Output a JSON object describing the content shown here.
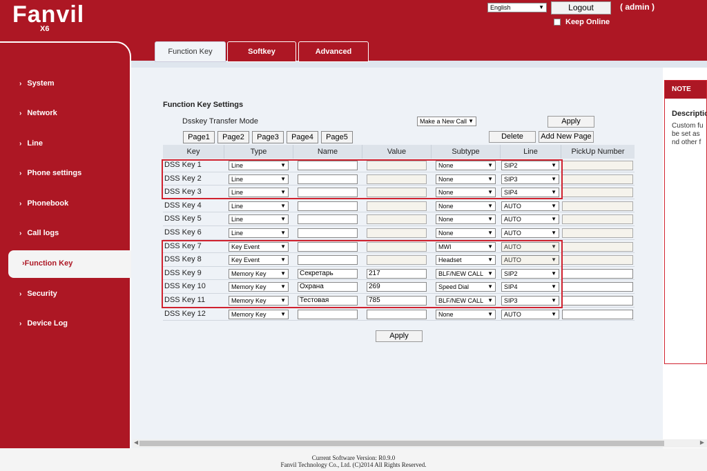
{
  "brand": {
    "logo": "Fanvil",
    "model": "X6"
  },
  "topbar": {
    "language": "English",
    "logout_label": "Logout",
    "user": "( admin )",
    "keep_online": "Keep Online"
  },
  "tabs": [
    {
      "label": "Function Key",
      "active": true
    },
    {
      "label": "Softkey",
      "active": false
    },
    {
      "label": "Advanced",
      "active": false
    }
  ],
  "sidebar": {
    "items": [
      {
        "label": "System"
      },
      {
        "label": "Network"
      },
      {
        "label": "Line"
      },
      {
        "label": "Phone settings"
      },
      {
        "label": "Phonebook"
      },
      {
        "label": "Call logs"
      },
      {
        "label": "Function Key",
        "active": true
      },
      {
        "label": "Security"
      },
      {
        "label": "Device Log"
      }
    ],
    "chevron": "›"
  },
  "settings": {
    "title": "Function Key Settings",
    "transfer_mode_label": "Dsskey Transfer Mode",
    "transfer_mode_value": "Make a New Call",
    "apply_label": "Apply",
    "delete_label": "Delete",
    "add_page_label": "Add New Page",
    "pages": [
      "Page1",
      "Page2",
      "Page3",
      "Page4",
      "Page5"
    ],
    "bottom_apply_label": "Apply"
  },
  "table": {
    "headers": [
      "Key",
      "Type",
      "Name",
      "Value",
      "Subtype",
      "Line",
      "PickUp Number"
    ],
    "rows": [
      {
        "key": "DSS Key 1",
        "type": "Line",
        "name": "",
        "value": "",
        "subtype": "None",
        "line": "SIP2",
        "pickup": ""
      },
      {
        "key": "DSS Key 2",
        "type": "Line",
        "name": "",
        "value": "",
        "subtype": "None",
        "line": "SIP3",
        "pickup": ""
      },
      {
        "key": "DSS Key 3",
        "type": "Line",
        "name": "",
        "value": "",
        "subtype": "None",
        "line": "SIP4",
        "pickup": ""
      },
      {
        "key": "DSS Key 4",
        "type": "Line",
        "name": "",
        "value": "",
        "subtype": "None",
        "line": "AUTO",
        "pickup": ""
      },
      {
        "key": "DSS Key 5",
        "type": "Line",
        "name": "",
        "value": "",
        "subtype": "None",
        "line": "AUTO",
        "pickup": ""
      },
      {
        "key": "DSS Key 6",
        "type": "Line",
        "name": "",
        "value": "",
        "subtype": "None",
        "line": "AUTO",
        "pickup": ""
      },
      {
        "key": "DSS Key 7",
        "type": "Key Event",
        "name": "",
        "value": "",
        "subtype": "MWI",
        "line": "AUTO",
        "pickup": ""
      },
      {
        "key": "DSS Key 8",
        "type": "Key Event",
        "name": "",
        "value": "",
        "subtype": "Headset",
        "line": "AUTO",
        "pickup": ""
      },
      {
        "key": "DSS Key 9",
        "type": "Memory Key",
        "name": "Секретарь",
        "value": "217",
        "subtype": "BLF/NEW CALL",
        "line": "SIP2",
        "pickup": ""
      },
      {
        "key": "DSS Key 10",
        "type": "Memory Key",
        "name": "Охрана",
        "value": "269",
        "subtype": "Speed Dial",
        "line": "SIP4",
        "pickup": ""
      },
      {
        "key": "DSS Key 11",
        "type": "Memory Key",
        "name": "Тестовая",
        "value": "785",
        "subtype": "BLF/NEW CALL",
        "line": "SIP3",
        "pickup": ""
      },
      {
        "key": "DSS Key 12",
        "type": "Memory Key",
        "name": "",
        "value": "",
        "subtype": "None",
        "line": "AUTO",
        "pickup": ""
      }
    ]
  },
  "note": {
    "header": "NOTE",
    "title": "Description",
    "lines": [
      "Custom fu",
      "be set as",
      "nd other f"
    ]
  },
  "footer": {
    "version": "Current Software Version: R0.9.0",
    "copyright": "Fanvil Technology Co., Ltd. (C)2014 All Rights Reserved."
  },
  "icons": {
    "dropdown": "▼",
    "scroll_left": "◀",
    "scroll_right": "▶"
  },
  "colors": {
    "brand_red": "#ad1724",
    "highlight_red": "#d0212e",
    "background": "#eef2f7"
  }
}
